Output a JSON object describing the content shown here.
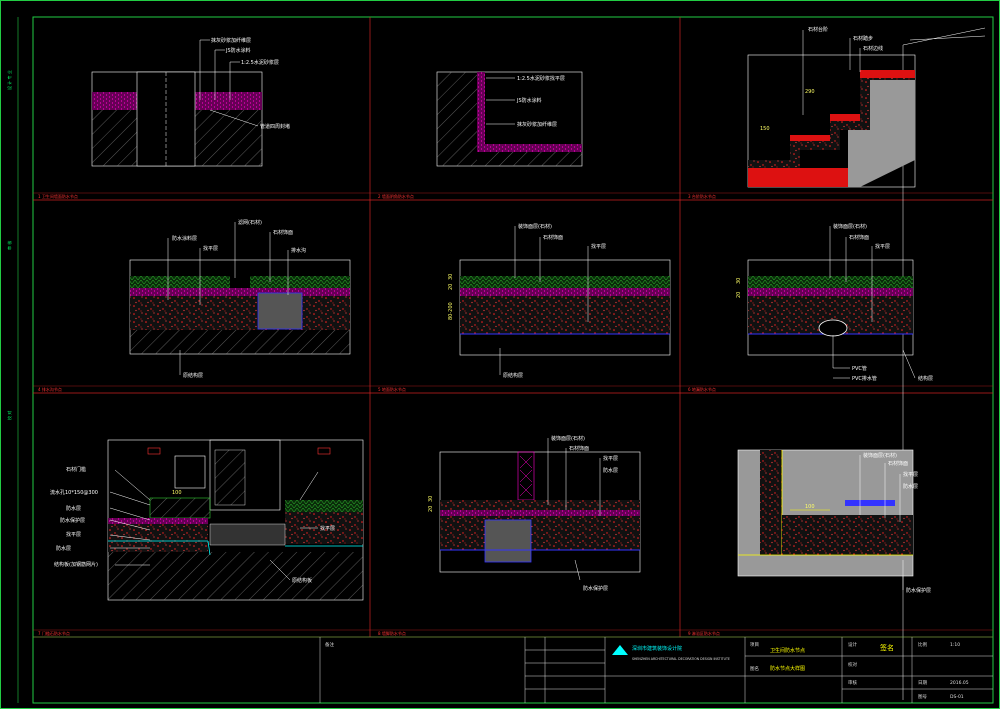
{
  "colors": {
    "frame": "#22cc44",
    "grid": "#cc2222",
    "red_fill": "#dd1111",
    "magenta": "#ff00cc",
    "green": "#33cc33",
    "gray": "#999999",
    "leader": "#ffffff",
    "blue": "#3333ff"
  },
  "details": [
    {
      "id": "d1",
      "labels": [
        "抹灰砂浆加纤维层",
        "JS防水涂料",
        "1:2.5水泥砂浆层",
        "管道四周封堵"
      ]
    },
    {
      "id": "d2",
      "labels": [
        "1:2.5水泥砂浆找平层",
        "JS防水涂料",
        "抹灰砂浆加纤维层"
      ]
    },
    {
      "id": "d3",
      "labels": [
        "石材台阶",
        "石材踏步",
        "石材边线",
        "290",
        "150"
      ]
    },
    {
      "id": "d4",
      "labels": [
        "防水涂料层",
        "滤网(石材)",
        "石材饰面",
        "找平层",
        "排水沟",
        "原结构层"
      ]
    },
    {
      "id": "d5",
      "labels": [
        "装饰面层(石材)",
        "石材饰面",
        "找平层",
        "原结构层",
        "80-200",
        "20",
        "30"
      ]
    },
    {
      "id": "d6",
      "labels": [
        "装饰面层(石材)",
        "石材饰面",
        "找平层",
        "PVC管",
        "PVC排水管",
        "结构层",
        "20",
        "30"
      ]
    },
    {
      "id": "d7",
      "labels": [
        "石材门槛",
        "流水孔10*150@300",
        "防水层",
        "防水保护层",
        "找平层",
        "防水层",
        "结构板(加钢筋网片)",
        "找平层",
        "原结构板",
        "100"
      ]
    },
    {
      "id": "d8",
      "labels": [
        "装饰面层(石材)",
        "石材饰面",
        "找平层",
        "防水层",
        "防水保护层",
        "20",
        "30"
      ]
    },
    {
      "id": "d9",
      "labels": [
        "装饰面层(石材)",
        "石材饰面",
        "找平层",
        "防水层",
        "100",
        "防水保护层"
      ]
    }
  ],
  "title_block": {
    "notes_label": "备注",
    "company": "深圳市建筑装饰设计院",
    "company_en": "SHENZHEN ARCHITECTURAL DECORATION DESIGN INSTITUTE",
    "project_label": "项目",
    "project_value": "卫生间防水节点",
    "drawing_label": "图名",
    "drawing_value": "防水节点大样图",
    "design_label": "设计",
    "check_label": "校对",
    "approve_label": "审核",
    "signature": "签名",
    "scale_label": "比例",
    "scale_value": "1:10",
    "date_label": "日期",
    "date_value": "2016.05",
    "sheet_label": "图号",
    "sheet_value": "DS-01"
  }
}
